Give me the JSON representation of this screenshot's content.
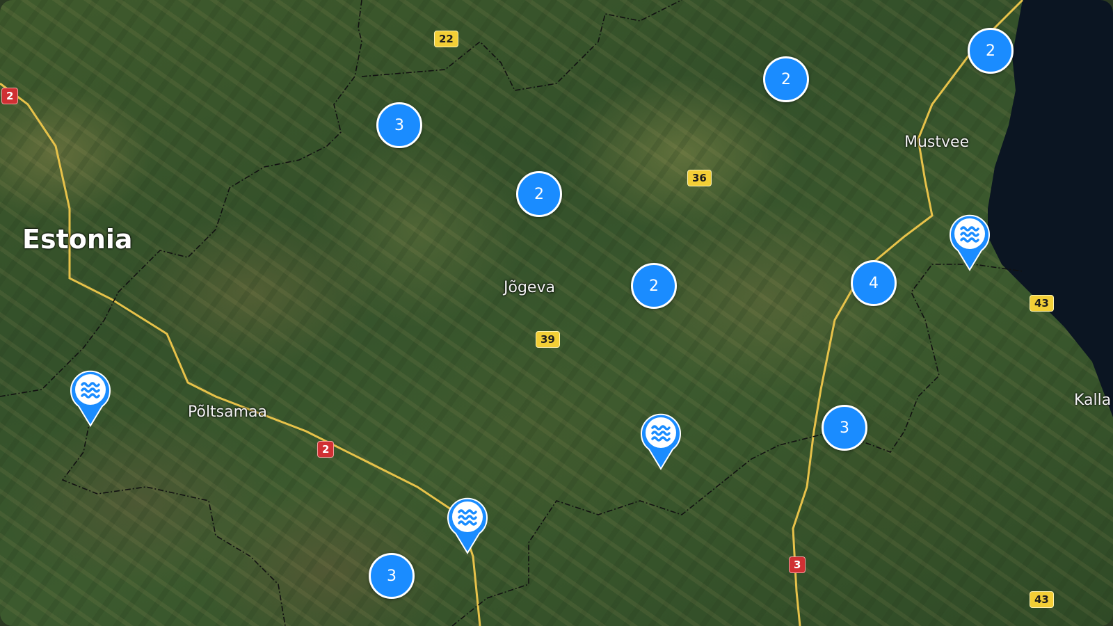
{
  "map": {
    "colors": {
      "cluster": "#1a8cff",
      "pin": "#1a8cff",
      "lake": "#0b1522",
      "road": "#e7c24a",
      "border": "#111111"
    },
    "places": {
      "country": "Estonia",
      "jogeva": "Jõgeva",
      "poltsamaa": "Põltsamaa",
      "mustvee": "Mustvee",
      "kalla": "Kalla"
    },
    "road_shields": [
      {
        "label": "22",
        "color": "yellow"
      },
      {
        "label": "2",
        "color": "red"
      },
      {
        "label": "36",
        "color": "yellow"
      },
      {
        "label": "39",
        "color": "yellow"
      },
      {
        "label": "2",
        "color": "red"
      },
      {
        "label": "43",
        "color": "yellow"
      },
      {
        "label": "3",
        "color": "red"
      },
      {
        "label": "43",
        "color": "yellow"
      }
    ],
    "clusters": [
      {
        "count": "3"
      },
      {
        "count": "2"
      },
      {
        "count": "2"
      },
      {
        "count": "2"
      },
      {
        "count": "2"
      },
      {
        "count": "4"
      },
      {
        "count": "3"
      },
      {
        "count": "3"
      }
    ],
    "water_pins": [
      {
        "icon": "water-waves-icon"
      },
      {
        "icon": "water-waves-icon"
      },
      {
        "icon": "water-waves-icon"
      },
      {
        "icon": "water-waves-icon"
      }
    ]
  }
}
